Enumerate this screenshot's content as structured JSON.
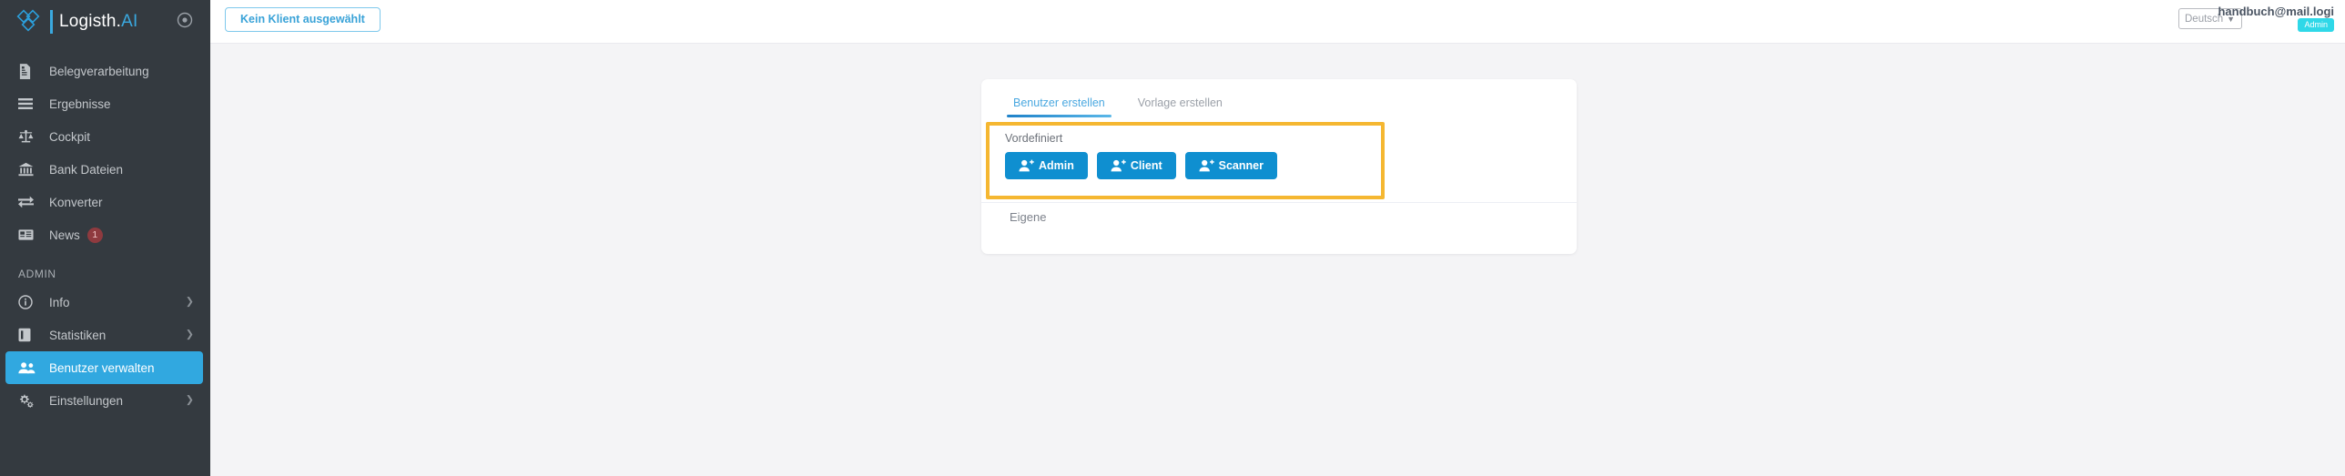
{
  "sidebar": {
    "logo": {
      "name": "Logisth.",
      "accent": "AI",
      "icon": "diamond-logo-icon"
    },
    "toggle_icon": "circle-target-icon",
    "items": [
      {
        "label": "Belegverarbeitung",
        "icon": "document-icon",
        "active": false,
        "chevron": false
      },
      {
        "label": "Ergebnisse",
        "icon": "list-lines-icon",
        "active": false,
        "chevron": false
      },
      {
        "label": "Cockpit",
        "icon": "balance-scale-icon",
        "active": false,
        "chevron": false
      },
      {
        "label": "Bank Dateien",
        "icon": "bank-icon",
        "active": false,
        "chevron": false
      },
      {
        "label": "Konverter",
        "icon": "exchange-arrows-icon",
        "active": false,
        "chevron": false
      },
      {
        "label": "News",
        "icon": "newspaper-icon",
        "active": false,
        "chevron": false,
        "badge": "1"
      }
    ],
    "admin_group_title": "ADMIN",
    "admin_items": [
      {
        "label": "Info",
        "icon": "info-circle-icon",
        "active": false,
        "chevron": true
      },
      {
        "label": "Statistiken",
        "icon": "book-icon",
        "active": false,
        "chevron": true
      },
      {
        "label": "Benutzer verwalten",
        "icon": "users-icon",
        "active": true,
        "chevron": false
      },
      {
        "label": "Einstellungen",
        "icon": "cogs-icon",
        "active": false,
        "chevron": true
      }
    ]
  },
  "topbar": {
    "client_button_label": "Kein Klient ausgewählt",
    "language_selected": "Deutsch",
    "language_options": [
      "Deutsch"
    ],
    "user_email": "handbuch@mail.logi",
    "user_role": "Admin"
  },
  "main": {
    "tabs": [
      {
        "label": "Benutzer erstellen",
        "active": true
      },
      {
        "label": "Vorlage erstellen",
        "active": false
      }
    ],
    "predefined_label": "Vordefiniert",
    "predefined_buttons": [
      {
        "label": "Admin",
        "icon": "user-plus-icon"
      },
      {
        "label": "Client",
        "icon": "user-plus-icon"
      },
      {
        "label": "Scanner",
        "icon": "user-plus-icon"
      }
    ],
    "own_label": "Eigene"
  },
  "colors": {
    "sidebar_bg": "#343a40",
    "accent_blue": "#31a8e0",
    "button_blue": "#0f8fd0",
    "highlight_orange": "#f5b731",
    "badge_cyan": "#2fd8e8",
    "badge_red": "#8f3a3f",
    "page_bg": "#f4f4f6"
  }
}
